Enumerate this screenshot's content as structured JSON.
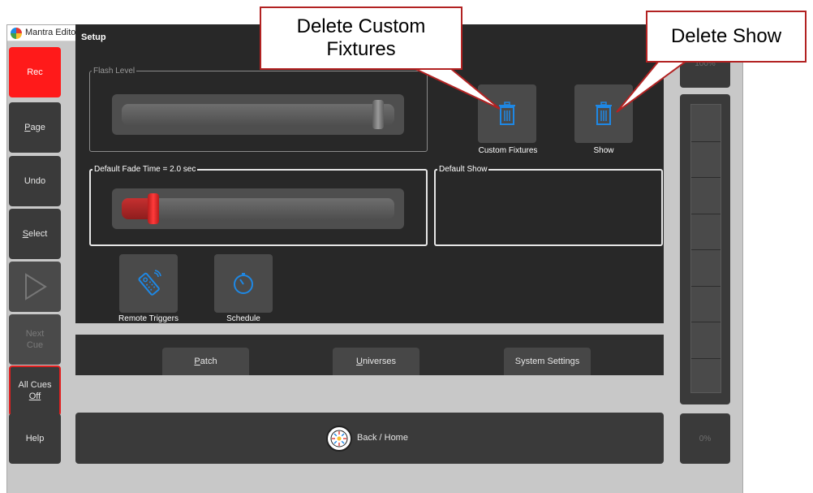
{
  "window": {
    "title": "Mantra Editor"
  },
  "left_buttons": [
    {
      "label": "Rec",
      "state": "active"
    },
    {
      "label": "Page",
      "underline": "P",
      "state": "normal"
    },
    {
      "label": "Undo",
      "state": "normal"
    },
    {
      "label": "Select",
      "underline": "S",
      "state": "normal"
    },
    {
      "label": "",
      "icon": "play-icon",
      "state": "disabled"
    },
    {
      "label": "Next Cue",
      "state": "disabled"
    },
    {
      "label_line1": "All Cues",
      "label_line2": "Off",
      "state": "outlined"
    },
    {
      "label": "Help",
      "state": "normal"
    }
  ],
  "setup": {
    "title": "Setup",
    "flash_level": {
      "legend": "Flash Level",
      "value": 0.96
    },
    "default_fade_time": {
      "legend": "Default Fade Time = 2.0 sec",
      "value": 0.1
    },
    "default_show": {
      "legend": "Default Show"
    }
  },
  "delete_tiles": [
    {
      "label": "Custom Fixtures",
      "icon": "trash-icon"
    },
    {
      "label": "Show",
      "icon": "trash-icon"
    }
  ],
  "tools": [
    {
      "label": "Remote Triggers",
      "icon": "remote-icon"
    },
    {
      "label": "Schedule",
      "icon": "timer-icon"
    }
  ],
  "bottom_tabs": [
    {
      "label": "Patch",
      "underline": "P"
    },
    {
      "label": "Universes",
      "underline": "U"
    },
    {
      "label": "System Settings",
      "underline": ""
    }
  ],
  "right_panel": {
    "top_label": "100%",
    "bottom_label": "0%"
  },
  "home": {
    "label": "Back / Home"
  },
  "callouts": [
    {
      "line1": "Delete Custom",
      "line2": "Fixtures"
    },
    {
      "text": "Delete Show"
    }
  ],
  "colors": {
    "accent_red": "#ff1a1a",
    "icon_blue": "#1e88e5",
    "panel_dark": "#282828",
    "callout_border": "#b22222"
  }
}
